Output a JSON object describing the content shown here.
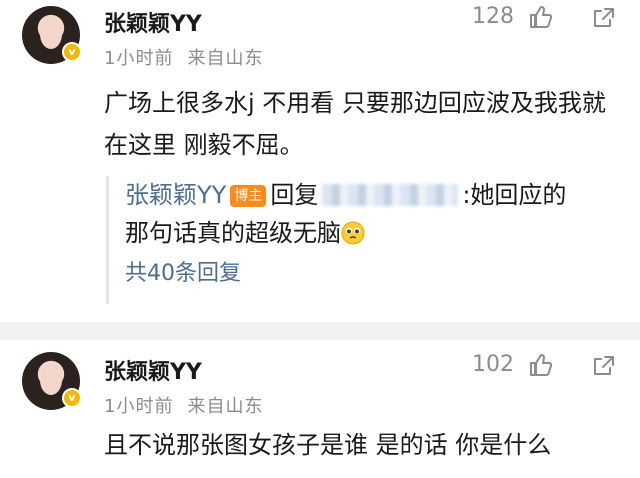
{
  "comments": [
    {
      "author": "张颖颖YY",
      "time": "1小时前",
      "location": "来自山东",
      "likes": "128",
      "text": "广场上很多水j 不用看 只要那边回应波及我我就在这里 刚毅不屈。",
      "reply": {
        "author": "张颖颖YY",
        "tag": "博主",
        "prefix": "回复",
        "text": ":她回应的那句话真的超级无脑",
        "count_label": "共40条回复"
      }
    },
    {
      "author": "张颖颖YY",
      "time": "1小时前",
      "location": "来自山东",
      "likes": "102",
      "text": "且不说那张图女孩子是谁 是的话 你是什么"
    }
  ],
  "icons": {
    "like": "thumbs-up-icon",
    "share": "share-icon",
    "badge": "verified-badge-icon",
    "emoji": "pleading-face-emoji-icon"
  },
  "colors": {
    "link": "#4d6e8f",
    "author_tag": "#ff8c1a",
    "meta": "#8c8c8c"
  }
}
